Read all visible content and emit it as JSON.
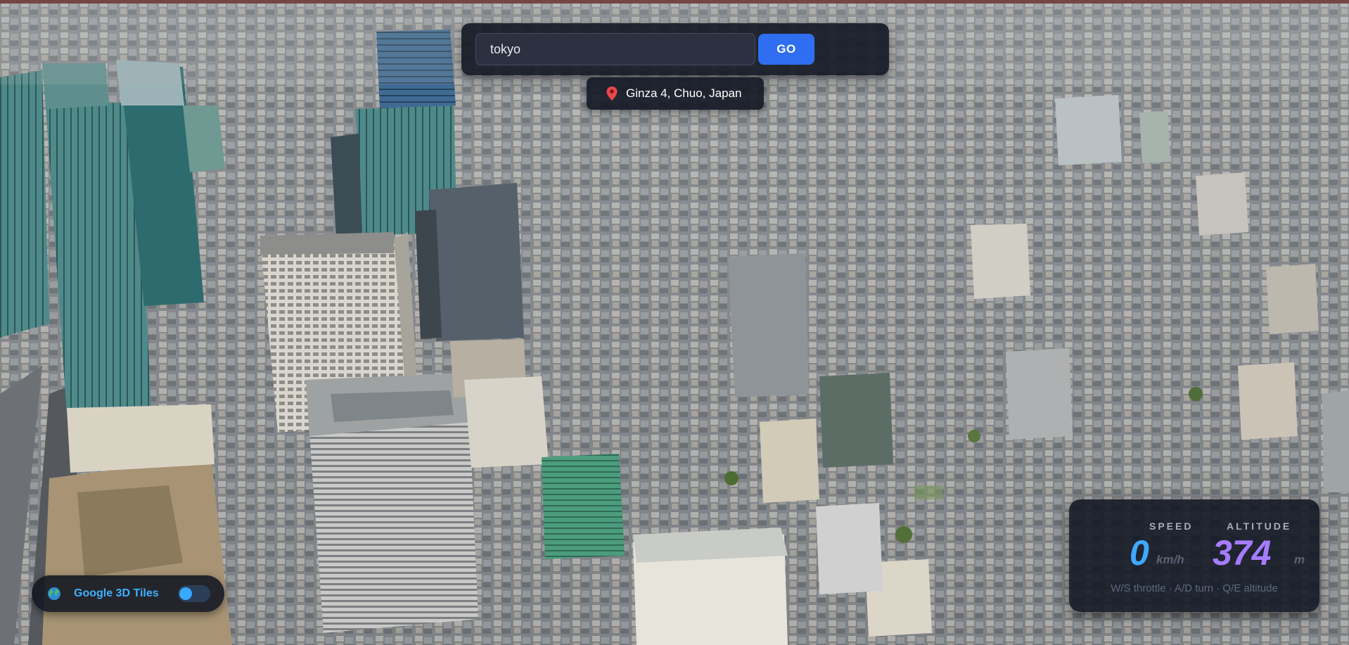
{
  "search": {
    "value": "tokyo",
    "go_label": "GO"
  },
  "location": {
    "icon": "map-pin-icon",
    "text": "Ginza 4, Chuo, Japan"
  },
  "tiles_toggle": {
    "icon": "globe-icon",
    "label": "Google 3D Tiles",
    "enabled": true
  },
  "hud": {
    "speed_label": "SPEED",
    "speed_value": "0",
    "speed_unit": "km/h",
    "altitude_label": "ALTITUDE",
    "altitude_value": "374",
    "altitude_unit": "m",
    "help": "W/S throttle · A/D turn · Q/E altitude"
  },
  "colors": {
    "accent_blue": "#2f6ef0",
    "speed_color": "#3da9ff",
    "altitude_color": "#a57cff",
    "panel_bg": "#161a26"
  }
}
